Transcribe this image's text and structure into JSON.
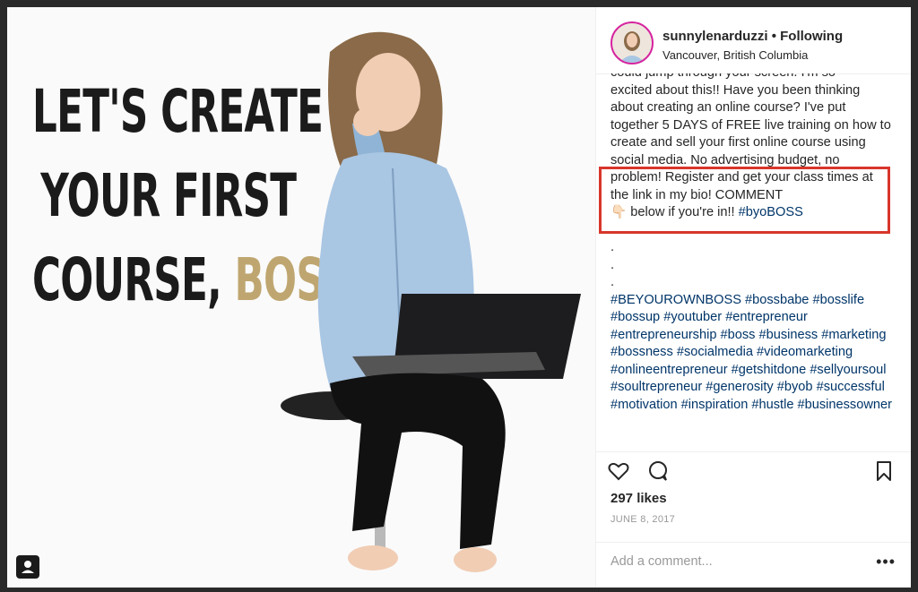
{
  "photo": {
    "headline_lines": [
      "LET'S CREATE",
      "YOUR FIRST",
      "COURSE, "
    ],
    "headline_accent": "BOSS",
    "headline_end": "!",
    "accent_color": "#bfa670"
  },
  "post": {
    "username": "sunnylenarduzzi",
    "separator": " • ",
    "follow_status": "Following",
    "location": "Vancouver, British Columbia",
    "caption_cut_line": "could jump through your screen. I'm so",
    "caption_body": "excited about this!! Have you been thinking about creating an online course? I've put together 5 DAYS of FREE live training on how to create and sell your first online course using social media. No advertising budget, no problem! Register and get your class times at the link in my bio! COMMENT",
    "caption_emoji": "👇🏻",
    "caption_after_emoji": " below if you're in!! ",
    "caption_tag": "#byoBOSS",
    "dots": [
      ".",
      ".",
      ".",
      "."
    ],
    "hashtags": "#BEYOURWNBOSS",
    "hashtag_block": "#BEYOUROWNBOSS #bossbabe #bosslife #bossup #youtuber #entrepreneur #entrepreneurship #boss #business #marketing #bossness #socialmedia #videomarketing #onlineentrepreneur #getshitdone #sellyoursoul #soultrepreneur #generosity #byob #successful #motivation #inspiration #hustle #businessowner",
    "likes": "297 likes",
    "date": "JUNE 8, 2017",
    "comment_placeholder": "Add a comment...",
    "more_label": "•••"
  }
}
